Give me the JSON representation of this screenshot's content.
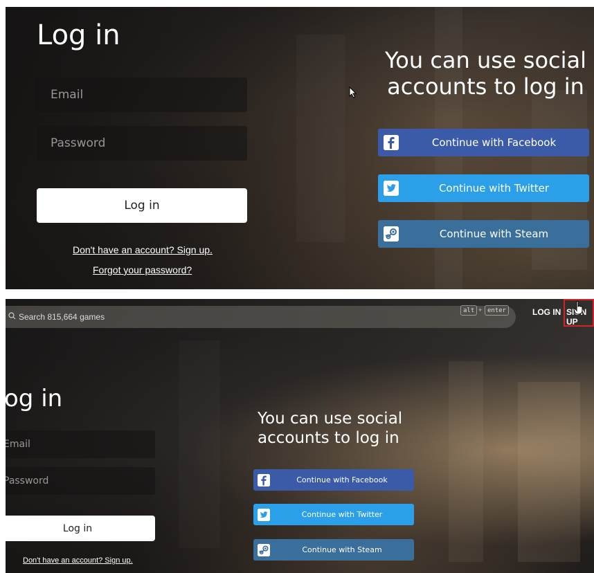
{
  "top": {
    "title": "Log in",
    "email_placeholder": "Email",
    "password_placeholder": "Password",
    "login_button": "Log in",
    "signup_link": "Don't have an account? Sign up.",
    "forgot_link": "Forgot your password?",
    "social_title_line1": "You can use social",
    "social_title_line2": "accounts to log in",
    "facebook_button": "Continue with Facebook",
    "twitter_button": "Continue with Twitter",
    "steam_button": "Continue with Steam"
  },
  "bottom": {
    "search_placeholder": "Search 815,664 games",
    "shortcut_key1": "alt",
    "shortcut_plus": "+",
    "shortcut_key2": "enter",
    "header_login": "LOG IN",
    "header_signup": "SIGN UP",
    "title": "og in",
    "email_placeholder": "Email",
    "password_placeholder": "Password",
    "login_button": "Log in",
    "signup_link": "Don't have an account? Sign up.",
    "social_title_line1": "You can use social",
    "social_title_line2": "accounts to log in",
    "facebook_button": "Continue with Facebook",
    "twitter_button": "Continue with Twitter",
    "steam_button": "Continue with Steam"
  },
  "colors": {
    "facebook": "#3b5ba9",
    "twitter": "#2ba0e8",
    "steam": "#3a6f9c",
    "highlight_box": "#d6202a"
  },
  "icons": [
    "facebook-icon",
    "twitter-icon",
    "steam-icon",
    "search-icon",
    "cursor-arrow-icon",
    "hand-pointer-icon"
  ]
}
